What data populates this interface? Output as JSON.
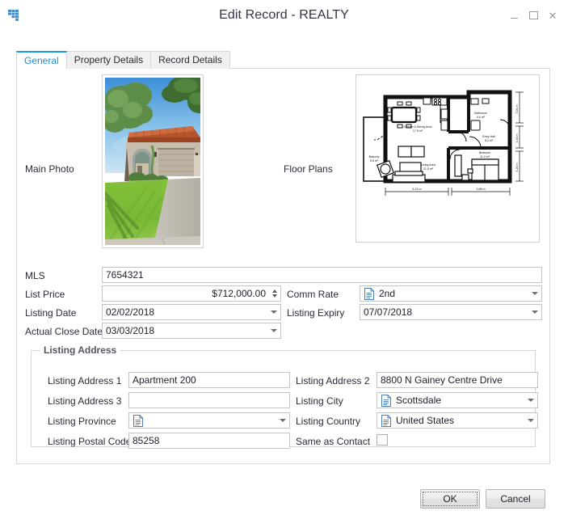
{
  "window": {
    "title": "Edit Record - REALTY",
    "icon": "app-grid-icon",
    "minimize_label": "–",
    "maximize_label": "□",
    "close_label": "×"
  },
  "tabs": [
    {
      "label": "General",
      "active": true
    },
    {
      "label": "Property Details",
      "active": false
    },
    {
      "label": "Record Details",
      "active": false
    }
  ],
  "media": {
    "main_photo_label": "Main Photo",
    "main_photo_alt": "Single story Mediterranean style house with tile roof, two car garage, palm and mesquite trees and a green front lawn",
    "floor_plans_label": "Floor Plans",
    "floor_plans_alt": "Architectural floor plan drawing showing kitchen and dining area, living area, bathroom, entry hall, bedroom and balcony with dimensions",
    "floor_plan_rooms": [
      {
        "name": "Kitchen & Dining Area",
        "area": "17.5 m²"
      },
      {
        "name": "Bathroom",
        "area": "4.0 m²"
      },
      {
        "name": "Entry Hall",
        "area": "6.2 m²"
      },
      {
        "name": "Living Area",
        "area": "21.5 m²"
      },
      {
        "name": "Bedroom",
        "area": "11.0 m²"
      },
      {
        "name": "Balcony",
        "area": "5.5 m²"
      }
    ],
    "floor_plan_dims": [
      "6.22 m",
      "3.68 m",
      "3.04 m",
      "4.48 m",
      "4.20 m"
    ]
  },
  "fields": {
    "mls": {
      "label": "MLS",
      "value": "7654321"
    },
    "list_price": {
      "label": "List Price",
      "value": "$712,000.00"
    },
    "comm_rate": {
      "label": "Comm Rate",
      "value": "2nd",
      "icon": "document-lookup-icon"
    },
    "listing_date": {
      "label": "Listing Date",
      "value": "02/02/2018"
    },
    "listing_expiry": {
      "label": "Listing Expiry",
      "value": "07/07/2018"
    },
    "actual_close_date": {
      "label": "Actual Close Date",
      "value": "03/03/2018"
    }
  },
  "listing_address": {
    "legend": "Listing Address",
    "address1": {
      "label": "Listing Address 1",
      "value": "Apartment 200"
    },
    "address2": {
      "label": "Listing Address 2",
      "value": "8800 N Gainey Centre Drive"
    },
    "address3": {
      "label": "Listing Address 3",
      "value": ""
    },
    "city": {
      "label": "Listing City",
      "value": "Scottsdale",
      "icon": "document-lookup-icon"
    },
    "province": {
      "label": "Listing Province",
      "value": "",
      "icon": "document-lookup-icon"
    },
    "country": {
      "label": "Listing Country",
      "value": "United States",
      "icon": "document-lookup-icon"
    },
    "postal_code": {
      "label": "Listing Postal Code",
      "value": "85258"
    },
    "same_as_contact": {
      "label": "Same as Contact",
      "checked": false
    }
  },
  "footer": {
    "ok_label": "OK",
    "cancel_label": "Cancel"
  },
  "colors": {
    "accent": "#1a9ada",
    "tab_active_text": "#1a8fd6",
    "field_border": "#c4c4c4",
    "panel_border": "#d7d7d7",
    "text": "#1f1f2b"
  }
}
